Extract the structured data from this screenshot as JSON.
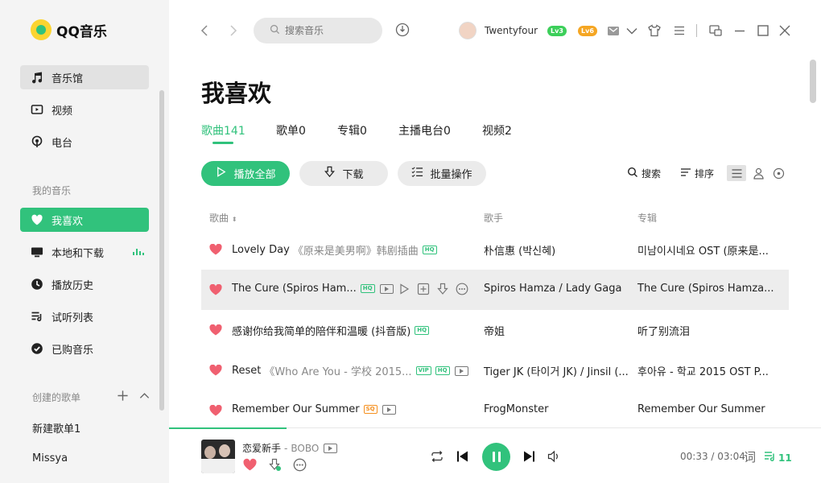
{
  "app": {
    "name": "QQ音乐"
  },
  "sidebar": {
    "top_items": [
      {
        "label": "音乐馆",
        "icon": "music-note-icon"
      },
      {
        "label": "视频",
        "icon": "video-icon"
      },
      {
        "label": "电台",
        "icon": "radio-icon"
      }
    ],
    "my_music_label": "我的音乐",
    "my_items": [
      {
        "label": "我喜欢",
        "icon": "heart-icon"
      },
      {
        "label": "本地和下载",
        "icon": "monitor-icon"
      },
      {
        "label": "播放历史",
        "icon": "history-icon"
      },
      {
        "label": "试听列表",
        "icon": "list-icon"
      },
      {
        "label": "已购音乐",
        "icon": "purchased-icon"
      }
    ],
    "created_label": "创建的歌单",
    "playlists": [
      "新建歌单1",
      "Missya"
    ]
  },
  "topbar": {
    "search_placeholder": "搜索音乐",
    "username": "Twentyfour",
    "level_badge": "Lv3",
    "vip_badge": "Lv6"
  },
  "page": {
    "title": "我喜欢",
    "tabs": [
      "歌曲141",
      "歌单0",
      "专辑0",
      "主播电台0",
      "视频2"
    ],
    "play_all": "播放全部",
    "download": "下载",
    "batch": "批量操作",
    "search_tool": "搜索",
    "sort_tool": "排序"
  },
  "table": {
    "headers": {
      "song": "歌曲",
      "artist": "歌手",
      "album": "专辑"
    },
    "rows": [
      {
        "title": "Lovely Day",
        "alt": "《原来是美男啊》韩剧插曲",
        "artist": "朴信惠 (박신혜)",
        "album": "미남이시네요 OST (原来是..."
      },
      {
        "title": "The Cure (Spiros Ham...",
        "alt": "",
        "artist": "Spiros Hamza / Lady Gaga",
        "album": "The Cure (Spiros Hamza..."
      },
      {
        "title": "感谢你给我简单的陪伴和温暖 (抖音版)",
        "alt": "",
        "artist": "帝姐",
        "album": "听了别流泪"
      },
      {
        "title": "Reset",
        "alt": "《Who Are You - 学校 2015...",
        "artist": "Tiger JK (타이거 JK) / Jinsil (...",
        "album": "후아유 - 학교 2015 OST P..."
      },
      {
        "title": "Remember Our Summer",
        "alt": "",
        "artist": "FrogMonster",
        "album": "Remember Our Summer"
      }
    ],
    "tags": {
      "hq": "HQ",
      "vip": "VIP",
      "sq": "SQ"
    }
  },
  "player": {
    "title": "恋爱新手",
    "separator": "-",
    "artist": "BOBO",
    "current_time": "00:33",
    "total_time": "03:04",
    "time_display": "00:33 / 03:04",
    "lyric_label": "词",
    "queue_count": "11",
    "progress": 0.18
  },
  "colors": {
    "accent": "#31c27c",
    "heart": "#f06070",
    "sidebar_bg": "#f4f4f4"
  }
}
